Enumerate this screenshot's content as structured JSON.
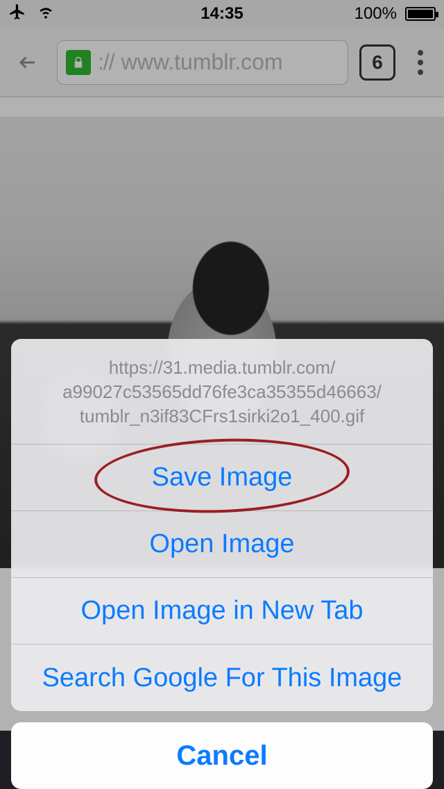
{
  "status": {
    "time": "14:35",
    "battery_text": "100%"
  },
  "browser": {
    "url_display_prefix": "://",
    "url_display_host": "www.tumblr.com",
    "tab_count": "6"
  },
  "sheet": {
    "header_line1": "https://31.media.tumblr.com/",
    "header_line2": "a99027c53565dd76fe3ca35355d46663/",
    "header_line3": "tumblr_n3if83CFrs1sirki2o1_400.gif",
    "items": {
      "save": "Save Image",
      "open": "Open Image",
      "open_new_tab": "Open Image in New Tab",
      "search_google": "Search Google For This Image"
    },
    "cancel": "Cancel"
  },
  "annotation": {
    "highlight": "save-image"
  }
}
